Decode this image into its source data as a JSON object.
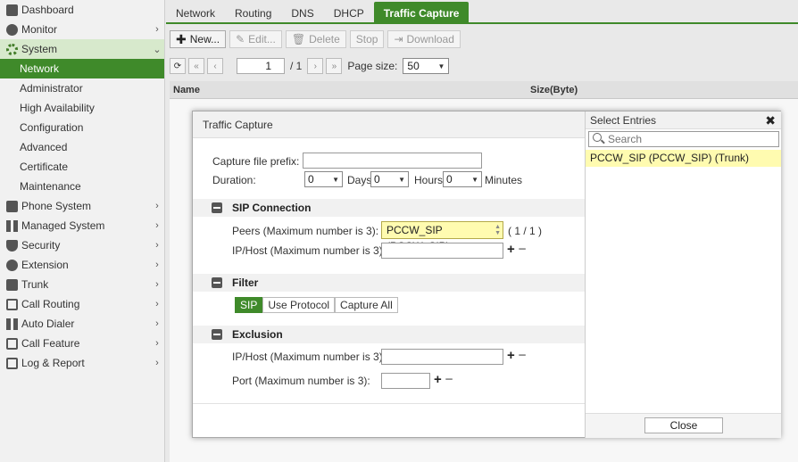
{
  "sidebar": {
    "items": [
      {
        "label": "Dashboard",
        "icon": "dashboard-icon"
      },
      {
        "label": "Monitor",
        "icon": "monitor-icon"
      },
      {
        "label": "System",
        "icon": "gear-icon"
      },
      {
        "label": "Network"
      },
      {
        "label": "Administrator"
      },
      {
        "label": "High Availability"
      },
      {
        "label": "Configuration"
      },
      {
        "label": "Advanced"
      },
      {
        "label": "Certificate"
      },
      {
        "label": "Maintenance"
      },
      {
        "label": "Phone System",
        "icon": "phone-icon"
      },
      {
        "label": "Managed System",
        "icon": "managed-system-icon"
      },
      {
        "label": "Security",
        "icon": "shield-icon"
      },
      {
        "label": "Extension",
        "icon": "extension-icon"
      },
      {
        "label": "Trunk",
        "icon": "trunk-icon"
      },
      {
        "label": "Call Routing",
        "icon": "call-routing-icon"
      },
      {
        "label": "Auto Dialer",
        "icon": "auto-dialer-icon"
      },
      {
        "label": "Call Feature",
        "icon": "call-feature-icon"
      },
      {
        "label": "Log & Report",
        "icon": "log-report-icon"
      }
    ]
  },
  "tabs": [
    "Network",
    "Routing",
    "DNS",
    "DHCP",
    "Traffic Capture"
  ],
  "toolbar": {
    "new": "New...",
    "edit": "Edit...",
    "delete": "Delete",
    "stop": "Stop",
    "download": "Download"
  },
  "pager": {
    "page": "1",
    "of": "/ 1",
    "page_size_label": "Page size:",
    "page_size": "50"
  },
  "list": {
    "col_name": "Name",
    "col_size": "Size(Byte)"
  },
  "dialog": {
    "title": "Traffic Capture",
    "prefix_label": "Capture file prefix:",
    "prefix_value": "",
    "duration_label": "Duration:",
    "days_value": "0",
    "days_label": "Days",
    "hours_value": "0",
    "hours_label": "Hours",
    "minutes_value": "0",
    "minutes_label": "Minutes",
    "sip_section": "SIP Connection",
    "peers_label": "Peers (Maximum number is 3):",
    "peers_value": "PCCW_SIP (PCCW_SIP)",
    "peers_count": "( 1 / 1 )",
    "sip_iphost_label": "IP/Host (Maximum number is 3):",
    "filter_section": "Filter",
    "filter_options": [
      "SIP",
      "Use Protocol",
      "Capture All"
    ],
    "exclusion_section": "Exclusion",
    "excl_iphost_label": "IP/Host (Maximum number is 3):",
    "excl_port_label": "Port (Maximum number is 3):"
  },
  "select_entries": {
    "title": "Select Entries",
    "search_placeholder": "Search",
    "entry": "PCCW_SIP (PCCW_SIP) (Trunk)",
    "close": "Close"
  }
}
